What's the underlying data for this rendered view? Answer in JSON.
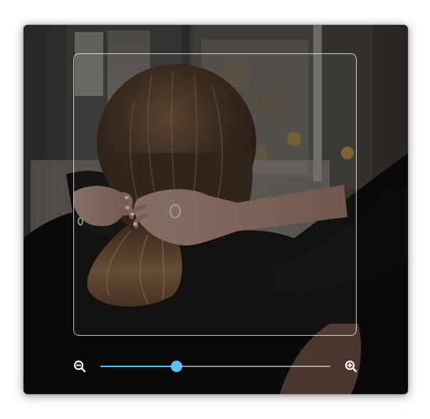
{
  "cropper": {
    "image_description_icon": "photo-subject",
    "zoom_out_icon": "zoom-out-icon",
    "zoom_in_icon": "zoom-in-icon",
    "zoom_level": 0.33,
    "accent_color": "#5cc2f2"
  }
}
